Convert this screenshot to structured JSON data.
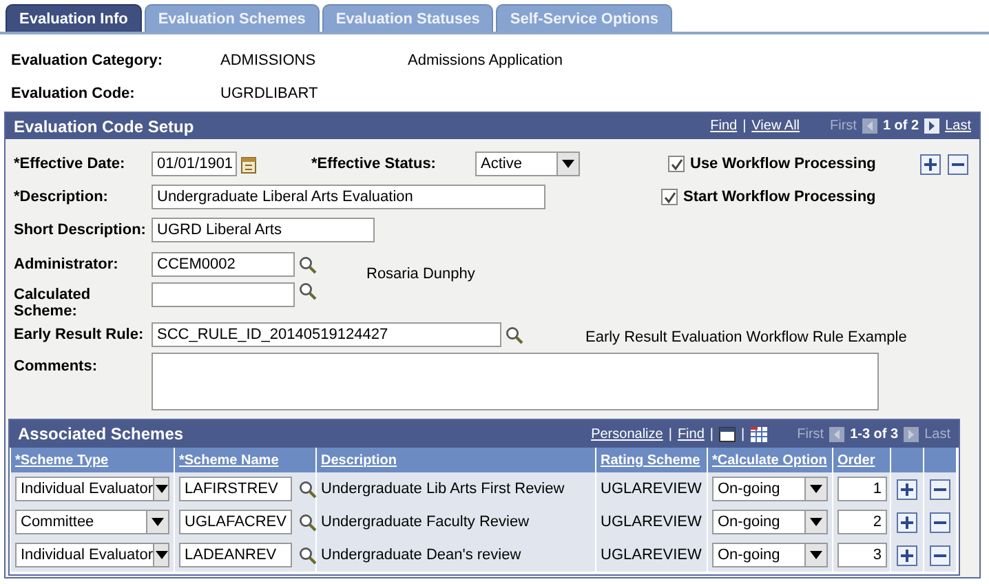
{
  "tabs": [
    {
      "label": "Evaluation Info",
      "selected": true
    },
    {
      "label": "Evaluation Schemes",
      "selected": false
    },
    {
      "label": "Evaluation Statuses",
      "selected": false
    },
    {
      "label": "Self-Service Options",
      "selected": false
    }
  ],
  "header": [
    {
      "label": "Evaluation Category:",
      "value": "ADMISSIONS",
      "description": "Admissions Application"
    },
    {
      "label": "Evaluation Code:",
      "value": "UGRDLIBART"
    }
  ],
  "setup": {
    "title": "Evaluation Code Setup",
    "links": [
      "Find",
      "View All"
    ],
    "separator": "|",
    "first": {
      "label": "First",
      "disabled": true
    },
    "page": "1 of 2",
    "last": {
      "label": "Last",
      "disabled": false
    },
    "effective_date": {
      "label": "*Effective Date:",
      "value": "01/01/1901"
    },
    "effective_status": {
      "label": "*Effective Status:",
      "value": "Active"
    },
    "checkboxes": [
      {
        "label": "Use Workflow Processing",
        "checked": true
      },
      {
        "label": "Start Workflow Processing",
        "checked": true
      }
    ],
    "description": {
      "label": "*Description:",
      "value": "Undergraduate Liberal Arts Evaluation"
    },
    "short_description": {
      "label": "Short Description:",
      "value": "UGRD Liberal Arts"
    },
    "administrator": {
      "label": "Administrator:",
      "value": "CCEM0002",
      "name": "Rosaria Dunphy"
    },
    "calculated_scheme": {
      "label": "Calculated Scheme:"
    },
    "early_result_rule": {
      "label": "Early Result Rule:",
      "value": "SCC_RULE_ID_20140519124427",
      "description": "Early Result Evaluation Workflow Rule Example"
    },
    "comments": {
      "label": "Comments:"
    }
  },
  "schemes": {
    "title": "Associated Schemes",
    "links": [
      "Personalize",
      "Find"
    ],
    "separator": "|",
    "first": {
      "label": "First",
      "disabled": true
    },
    "page": "1-3 of 3",
    "last": {
      "label": "Last",
      "disabled": true
    },
    "columns": [
      "*Scheme Type",
      "*Scheme Name",
      "Description",
      "Rating Scheme",
      "*Calculate Option",
      "Order"
    ],
    "rows": [
      {
        "scheme_type": "Individual Evaluator",
        "scheme_name": "LAFIRSTREV",
        "description": "Undergraduate Lib Arts First Review",
        "rating_scheme": "UGLAREVIEW",
        "calculate_option": "On-going",
        "order": "1"
      },
      {
        "scheme_type": "Committee",
        "scheme_name": "UGLAFACREV",
        "description": "Undergraduate Faculty Review",
        "rating_scheme": "UGLAREVIEW",
        "calculate_option": "On-going",
        "order": "2"
      },
      {
        "scheme_type": "Individual Evaluator",
        "scheme_name": "LADEANREV",
        "description": "Undergraduate Dean's review",
        "rating_scheme": "UGLAREVIEW",
        "calculate_option": "On-going",
        "order": "3"
      }
    ]
  }
}
